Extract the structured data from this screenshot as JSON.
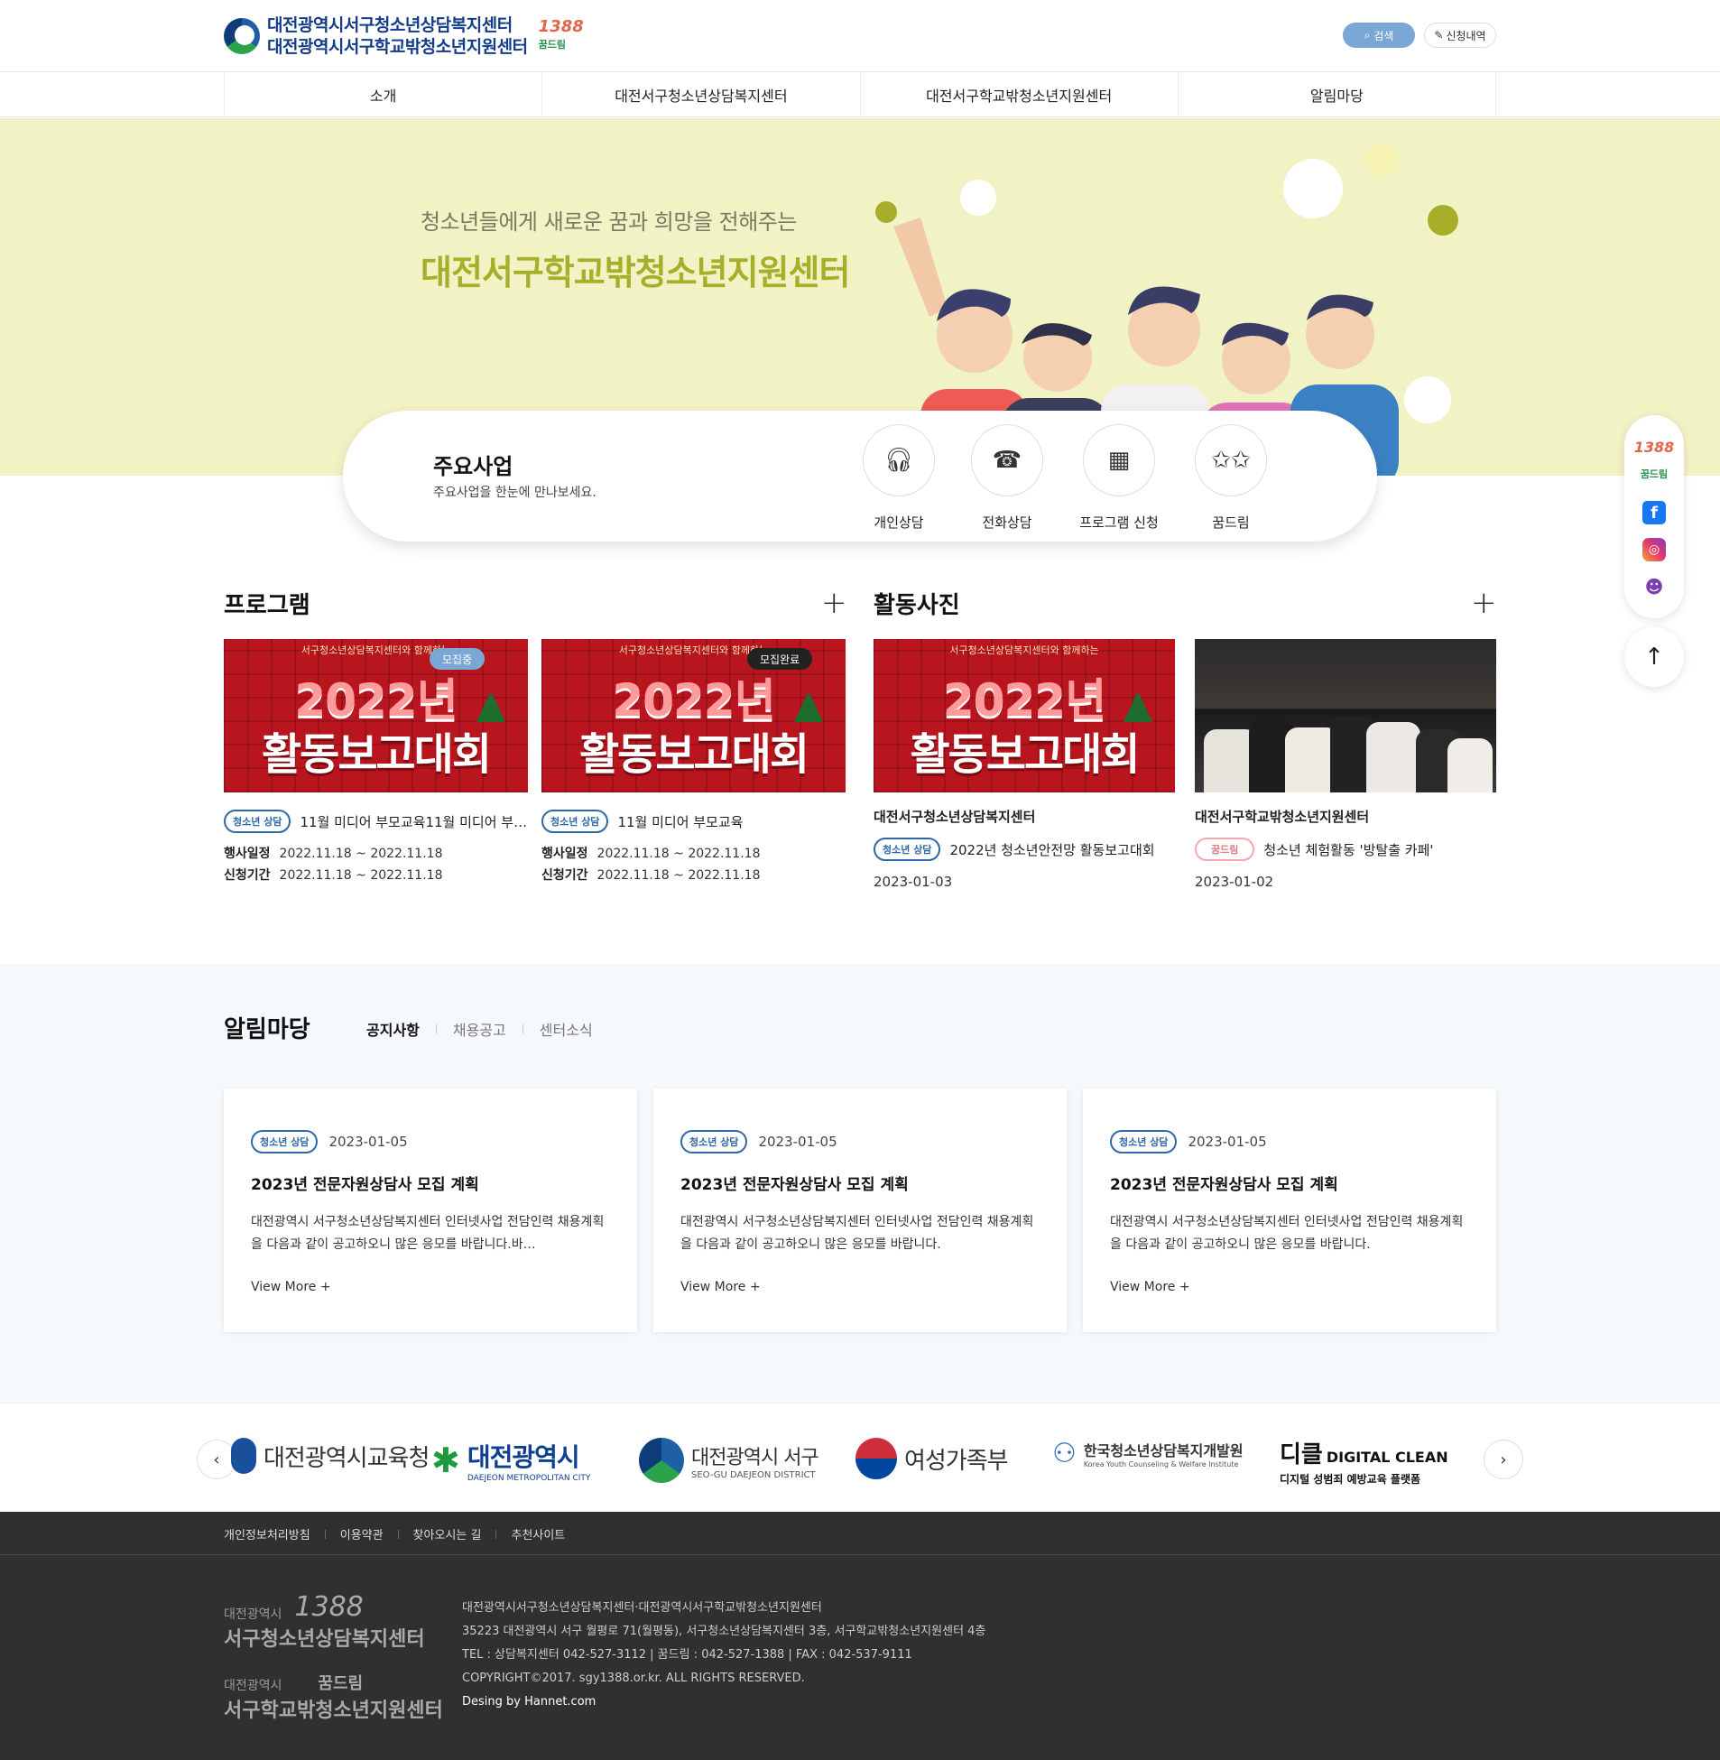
{
  "header": {
    "logo_line1": "대전광역시서구청소년상담복지센터",
    "logo_line2": "대전광역시서구학교밖청소년지원센터",
    "badge_1388": "1388",
    "badge_dream": "꿈드림",
    "search_label": "검색",
    "apply_label": "신청내역"
  },
  "nav": [
    "소개",
    "대전서구청소년상담복지센터",
    "대전서구학교밖청소년지원센터",
    "알림마당"
  ],
  "hero": {
    "subtitle": "청소년들에게 새로운 꿈과 희망을 전해주는",
    "title": "대전서구학교밖청소년지원센터"
  },
  "business": {
    "title": "주요사업",
    "desc": "주요사업을 한눈에 만나보세요.",
    "items": [
      "개인상담",
      "전화상담",
      "프로그램 신청",
      "꿈드림"
    ]
  },
  "quick": {
    "badge_1388": "1388",
    "badge_dream": "꿈드림"
  },
  "program": {
    "title": "프로그램",
    "banner_top": "서구청소년상담복지센터와 함께하는",
    "banner_year": "2022년",
    "banner_main": "활동보고대회",
    "items": [
      {
        "status": "모집중",
        "tag": "청소년 상담",
        "title": "11월 미디어 부모교육11월 미디어 부…",
        "event_label": "행사일정",
        "event": "2022.11.18 ~ 2022.11.18",
        "apply_label": "신청기간",
        "apply": "2022.11.18 ~ 2022.11.18"
      },
      {
        "status": "모집완료",
        "tag": "청소년 상담",
        "title": "11월 미디어 부모교육",
        "event_label": "행사일정",
        "event": "2022.11.18 ~ 2022.11.18",
        "apply_label": "신청기간",
        "apply": "2022.11.18 ~ 2022.11.18"
      }
    ]
  },
  "gallery": {
    "title": "활동사진",
    "items": [
      {
        "center": "대전서구청소년상담복지센터",
        "tag": "청소년 상담",
        "title": "2022년 청소년안전망 활동보고대회",
        "date": "2023-01-03"
      },
      {
        "center": "대전서구학교밖청소년지원센터",
        "tag": "꿈드림",
        "title": "청소년 체험활동 '방탈출 카페'",
        "date": "2023-01-02"
      }
    ]
  },
  "notice": {
    "title": "알림마당",
    "tabs": [
      "공지사항",
      "채용공고",
      "센터소식"
    ],
    "cards": [
      {
        "tag": "청소년 상담",
        "date": "2023-01-05",
        "title": "2023년 전문자원상담사 모집 계획",
        "body": "대전광역시 서구청소년상담복지센터 인터넷사업 전담인력 채용계획을 다음과 같이 공고하오니 많은 응모를 바랍니다.바…",
        "more": "View More +"
      },
      {
        "tag": "청소년 상담",
        "date": "2023-01-05",
        "title": "2023년 전문자원상담사 모집 계획",
        "body": "대전광역시 서구청소년상담복지센터 인터넷사업 전담인력 채용계획을 다음과 같이 공고하오니 많은 응모를 바랍니다.",
        "more": "View More +"
      },
      {
        "tag": "청소년 상담",
        "date": "2023-01-05",
        "title": "2023년 전문자원상담사 모집 계획",
        "body": "대전광역시 서구청소년상담복지센터 인터넷사업 전담인력 채용계획을 다음과 같이 공고하오니 많은 응모를 바랍니다.",
        "more": "View More +"
      }
    ]
  },
  "partners": {
    "edu": "대전광역시교육청",
    "city": "대전광역시",
    "city_en": "DAEJEON METROPOLITAN CITY",
    "seogu": "대전광역시 서구",
    "seogu_en": "SEO-GU DAEJEON DISTRICT",
    "mogef": "여성가족부",
    "kyci": "한국청소년상담복지개발원",
    "kyci_en": "Korea Youth Counseling & Welfare Institute",
    "dc_mark": "디클",
    "dc_name": "DIGITAL CLEAN",
    "dc_desc": "디지털 성범죄 예방교육 플랫폼"
  },
  "footer": {
    "links": [
      "개인정보처리방침",
      "이용약관",
      "찾아오시는 길",
      "추천사이트"
    ],
    "logo1_small": "대전광역시",
    "logo1_big": "서구청소년상담복지센터",
    "logo1_badge": "1388",
    "logo2_small": "대전광역시",
    "logo2_big": "서구학교밖청소년지원센터",
    "logo2_badge": "꿈드림",
    "line1": "대전광역시서구청소년상담복지센터·대전광역시서구학교밖청소년지원센터",
    "line2": "35223 대전광역시 서구 월평로 71(월평동), 서구청소년상담복지센터 3층, 서구학교밖청소년지원센터 4층",
    "line3": "TEL : 상담복지센터 042-527-3112 | 꿈드림 : 042-527-1388 | FAX : 042-537-9111",
    "line4": "COPYRIGHT©2017. sgy1388.or.kr. ALL RIGHTS RESERVED.",
    "line5": "Desing by Hannet.com"
  },
  "colors": {
    "brand_navy": "#143c88",
    "hero_bg": "#f2f3c5",
    "hero_title": "#a7ae2a",
    "tag_blue": "#2f68a8",
    "footer_bg": "#303030"
  }
}
